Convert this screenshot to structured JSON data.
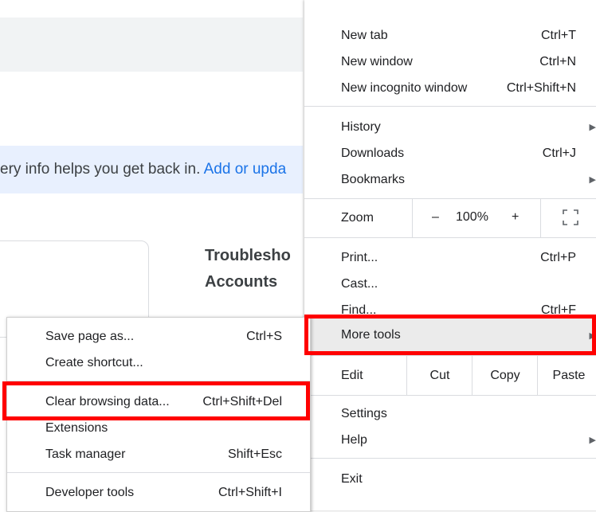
{
  "background": {
    "banner_text": "ery info helps you get back in. ",
    "banner_link": "Add or upda",
    "heading_line1": "Troublesho",
    "heading_line2": "Accounts"
  },
  "menu": {
    "items": {
      "new_tab": {
        "label": "New tab",
        "shortcut": "Ctrl+T"
      },
      "new_window": {
        "label": "New window",
        "shortcut": "Ctrl+N"
      },
      "new_incognito": {
        "label": "New incognito window",
        "shortcut": "Ctrl+Shift+N"
      },
      "history": {
        "label": "History"
      },
      "downloads": {
        "label": "Downloads",
        "shortcut": "Ctrl+J"
      },
      "bookmarks": {
        "label": "Bookmarks"
      },
      "print": {
        "label": "Print...",
        "shortcut": "Ctrl+P"
      },
      "cast": {
        "label": "Cast..."
      },
      "find": {
        "label": "Find...",
        "shortcut": "Ctrl+F"
      },
      "more_tools": {
        "label": "More tools"
      },
      "settings": {
        "label": "Settings"
      },
      "help": {
        "label": "Help"
      },
      "exit": {
        "label": "Exit"
      }
    },
    "zoom": {
      "label": "Zoom",
      "minus": "–",
      "level": "100%",
      "plus": "+"
    },
    "edit": {
      "label": "Edit",
      "cut": "Cut",
      "copy": "Copy",
      "paste": "Paste"
    }
  },
  "submenu": {
    "items": {
      "save_page": {
        "label": "Save page as...",
        "shortcut": "Ctrl+S"
      },
      "create_shortcut": {
        "label": "Create shortcut..."
      },
      "clear_browsing": {
        "label": "Clear browsing data...",
        "shortcut": "Ctrl+Shift+Del"
      },
      "extensions": {
        "label": "Extensions"
      },
      "task_manager": {
        "label": "Task manager",
        "shortcut": "Shift+Esc"
      },
      "developer_tools": {
        "label": "Developer tools",
        "shortcut": "Ctrl+Shift+I"
      }
    }
  },
  "colors": {
    "highlight": "#ff0000",
    "link": "#1a73e8",
    "banner_bg": "#e8f0fe"
  }
}
